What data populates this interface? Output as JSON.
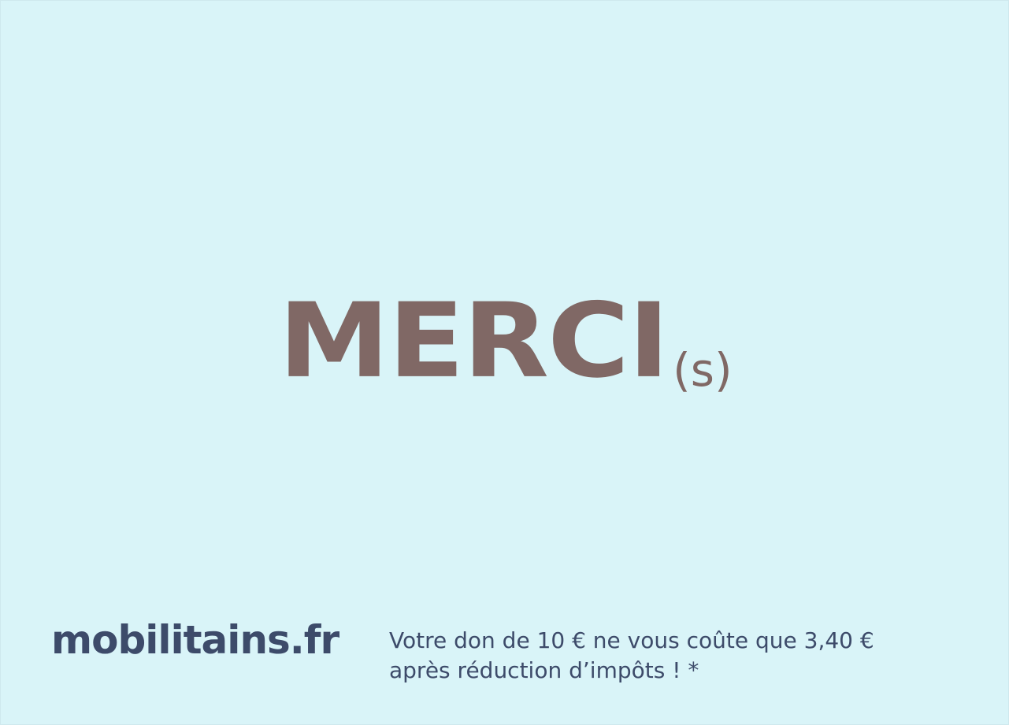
{
  "headline": {
    "main": "MERCI",
    "suffix": "(s)"
  },
  "footer": {
    "site": "mobilitains.fr",
    "note_line1": "Votre don de 10 € ne vous coûte que 3,40 €",
    "note_line2": "après réduction d’impôts ! *"
  },
  "colors": {
    "background": "#d9f4f8",
    "headline": "#806865",
    "footer_text": "#3d4b6a"
  }
}
